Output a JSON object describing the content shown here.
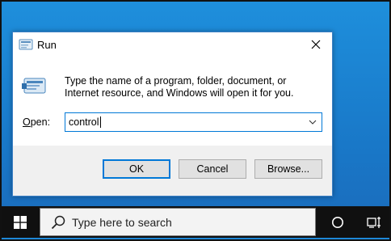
{
  "dialog": {
    "title": "Run",
    "icon": "run-icon",
    "description": "Type the name of a program, folder, document, or Internet resource, and Windows will open it for you.",
    "open_label_accel": "O",
    "open_label_rest": "pen:",
    "open_value": "control",
    "buttons": {
      "ok": "OK",
      "cancel": "Cancel",
      "browse": "Browse..."
    }
  },
  "taskbar": {
    "search_placeholder": "Type here to search",
    "icons": [
      "windows-logo-icon",
      "search-icon",
      "cortana-icon",
      "task-view-icon"
    ]
  },
  "colors": {
    "desktop": "#1e88d8",
    "accent": "#0078d7",
    "taskbar": "#101010"
  }
}
